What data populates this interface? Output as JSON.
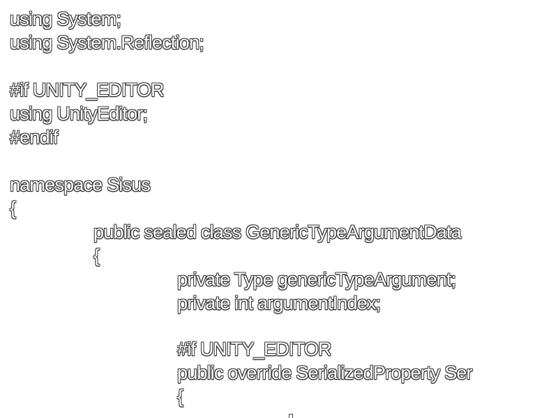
{
  "code": {
    "lines": [
      "using System;",
      "using System.Reflection;",
      "#if UNITY_EDITOR",
      "using UnityEditor;",
      "#endif",
      "namespace Sisus",
      "{",
      "public sealed class GenericTypeArgumentData",
      "{",
      "private Type genericTypeArgument;",
      "private int argumentIndex;",
      "#if UNITY_EDITOR",
      "public override SerializedProperty Ser",
      "{"
    ]
  }
}
